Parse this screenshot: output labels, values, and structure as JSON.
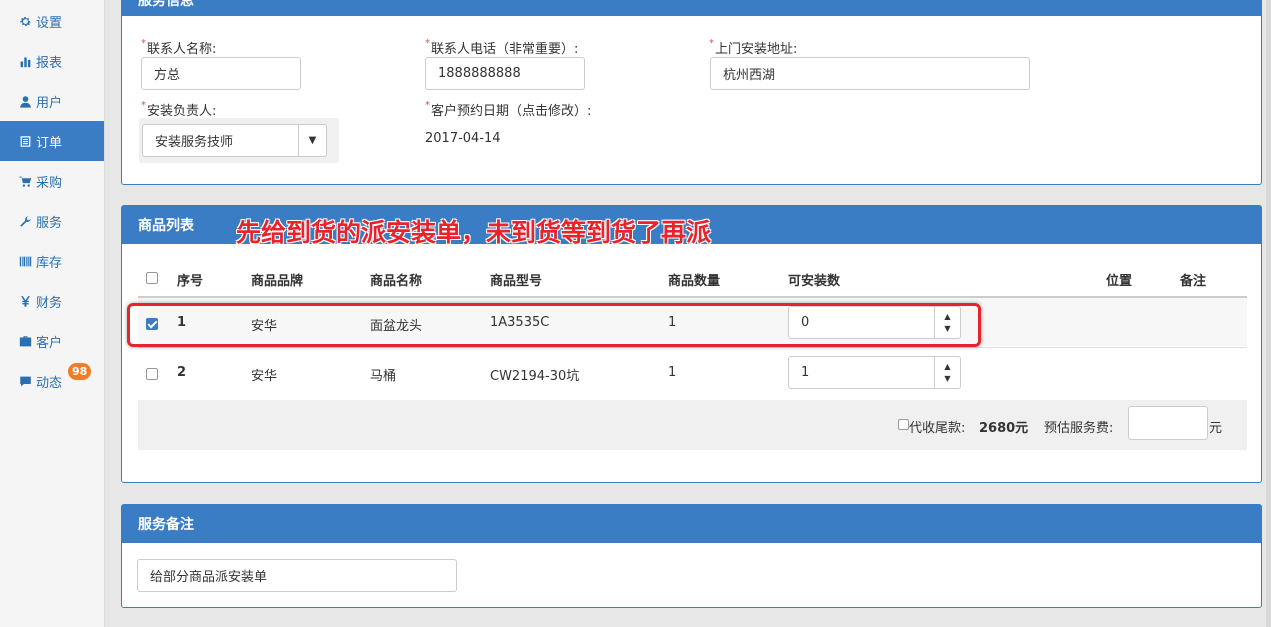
{
  "sidebar": {
    "items": [
      {
        "label": "设置",
        "icon": "gear-icon"
      },
      {
        "label": "报表",
        "icon": "bar-chart-icon"
      },
      {
        "label": "用户",
        "icon": "user-icon"
      },
      {
        "label": "订单",
        "icon": "list-icon",
        "active": true
      },
      {
        "label": "采购",
        "icon": "cart-icon"
      },
      {
        "label": "服务",
        "icon": "wrench-icon"
      },
      {
        "label": "库存",
        "icon": "barcode-icon"
      },
      {
        "label": "财务",
        "icon": "yen-icon"
      },
      {
        "label": "客户",
        "icon": "briefcase-icon"
      },
      {
        "label": "动态",
        "icon": "comment-icon",
        "badge": "98"
      }
    ]
  },
  "service_info": {
    "title": "服务信息",
    "contact_name_label": "联系人名称:",
    "contact_name_value": "方总",
    "contact_phone_label": "联系人电话（非常重要）:",
    "contact_phone_value": "1888888888",
    "address_label": "上门安装地址:",
    "address_value": "杭州西湖",
    "installer_label": "安装负责人:",
    "installer_value": "安装服务技师",
    "appointment_label": "客户预约日期（点击修改）:",
    "appointment_value": "2017-04-14",
    "required_mark": "*"
  },
  "product_list": {
    "title": "商品列表",
    "annotation": "先给到货的派安装单，未到货等到货了再派",
    "columns": {
      "index": "序号",
      "brand": "商品品牌",
      "name": "商品名称",
      "model": "商品型号",
      "quantity": "商品数量",
      "installable": "可安装数",
      "location": "位置",
      "remark": "备注"
    },
    "rows": [
      {
        "index": "1",
        "brand": "安华",
        "name": "面盆龙头",
        "model": "1A3535C",
        "quantity": "1",
        "installable": "0",
        "checked": true
      },
      {
        "index": "2",
        "brand": "安华",
        "name": "马桶",
        "model": "CW2194-30坑",
        "quantity": "1",
        "installable": "1",
        "checked": false
      }
    ],
    "cod_label": "代收尾款:",
    "cod_value": "2680元",
    "fee_label": "预估服务费:",
    "fee_value": "",
    "fee_unit": "元"
  },
  "service_remark": {
    "title": "服务备注",
    "value": "给部分商品派安装单"
  },
  "colors": {
    "primary": "#3a7dc4",
    "annotation": "#e8232b",
    "badge": "#f07c23"
  }
}
